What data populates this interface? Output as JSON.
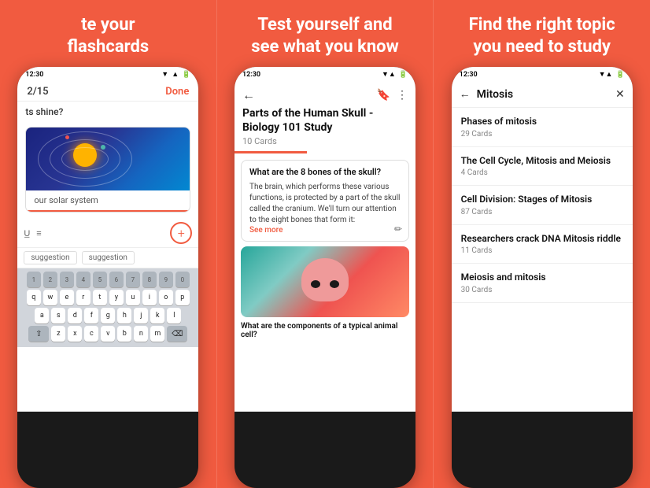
{
  "panel1": {
    "heading": "te your\nflashcards",
    "topbar": {
      "count": "2/15",
      "done": "Done"
    },
    "question": "ts shine?",
    "answer_input": "our solar system",
    "suggestions": [
      "suggestion",
      "suggestion"
    ],
    "keyboard": {
      "row1": [
        "q",
        "w",
        "e",
        "r",
        "t",
        "y",
        "u",
        "i",
        "o",
        "p"
      ],
      "row2": [
        "a",
        "s",
        "d",
        "f",
        "g",
        "h",
        "j",
        "k",
        "l"
      ],
      "row3": [
        "z",
        "x",
        "c",
        "v",
        "b",
        "n",
        "m"
      ],
      "nums": [
        "1",
        "2",
        "3",
        "4",
        "5",
        "6",
        "7",
        "8",
        "9",
        "0"
      ]
    },
    "status": {
      "time": "12:30"
    }
  },
  "panel2": {
    "heading": "Test yourself and\nsee what you know",
    "topbar": {},
    "title": "Parts of the Human Skull - Biology 101 Study",
    "card_count": "10 Cards",
    "question": "What are the 8 bones of the skull?",
    "answer": "The brain, which performs these various functions, is protected by a part of the skull called the cranium. We'll turn our attention to the eight bones that form it:",
    "see_more": "See more",
    "next_question": "What are the components of a typical animal cell?",
    "status": {
      "time": "12:30"
    }
  },
  "panel3": {
    "heading": "Find the right topic\nyou need to study",
    "search_title": "Mitosis",
    "items": [
      {
        "title": "Phases of mitosis",
        "count": "29 Cards"
      },
      {
        "title": "The Cell Cycle, Mitosis and Meiosis",
        "count": "4 Cards"
      },
      {
        "title": "Cell Division: Stages of Mitosis",
        "count": "87 Cards"
      },
      {
        "title": "Researchers crack DNA Mitosis riddle",
        "count": "11 Cards"
      },
      {
        "title": "Meiosis and mitosis",
        "count": "30 Cards"
      }
    ],
    "status": {
      "time": "12:30"
    }
  }
}
